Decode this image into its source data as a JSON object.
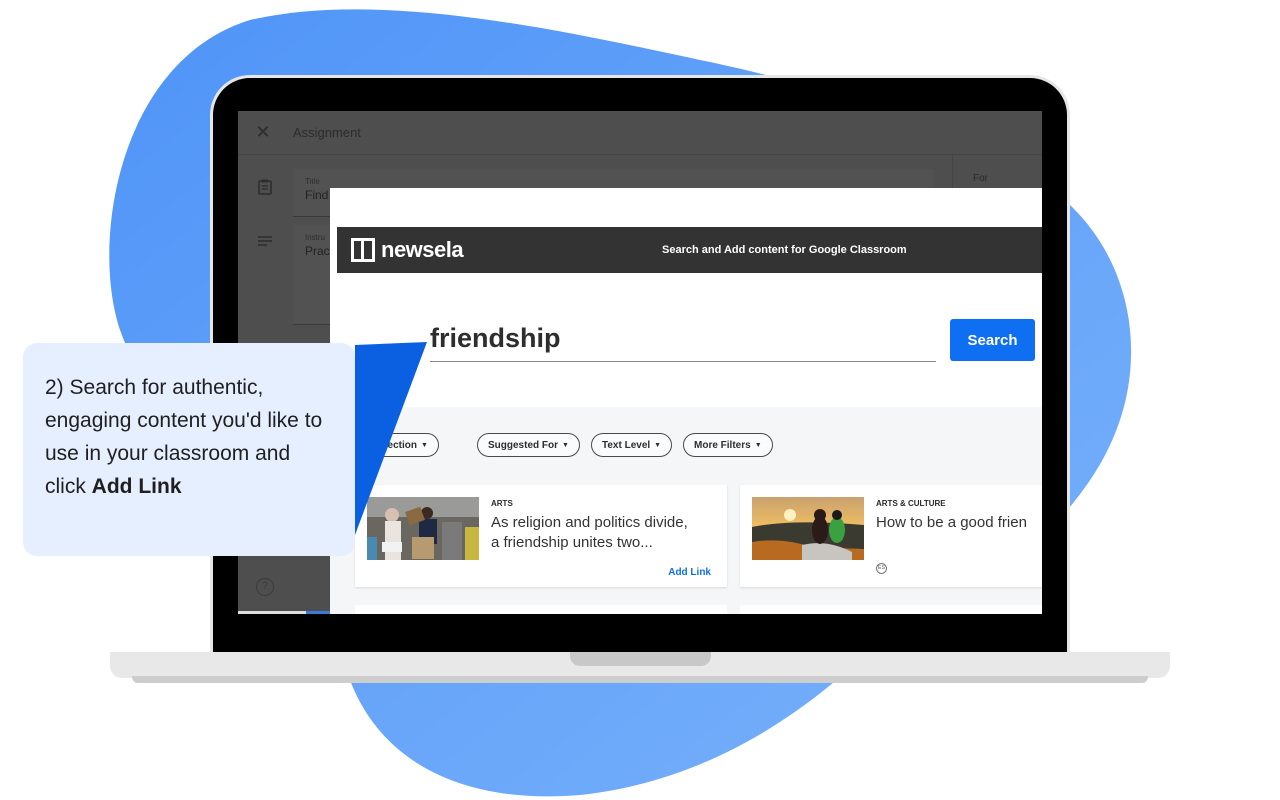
{
  "classroom": {
    "header_title": "Assignment",
    "title_field": {
      "label": "Title",
      "value": "Find"
    },
    "instructions_field": {
      "label": "Instru",
      "value": "Prac"
    },
    "right_panel_label": "For"
  },
  "newsela": {
    "logo_text": "newsela",
    "bar_caption": "Search and Add content for Google Classroom",
    "search": {
      "value": "friendship",
      "placeholder": "",
      "button_label": "Search"
    },
    "filters": [
      {
        "label": "m Collection"
      },
      {
        "label": "Suggested For"
      },
      {
        "label": "Text Level"
      },
      {
        "label": "More Filters"
      }
    ],
    "cards": [
      {
        "category": "ARTS",
        "title_line1": "As religion and politics divide,",
        "title_line2": "a friendship unites two...",
        "action_label": "Add Link"
      },
      {
        "category": "ARTS & CULTURE",
        "title_line1": "How to be a good frien",
        "title_line2": "",
        "language_badge": "ES"
      }
    ]
  },
  "callout": {
    "text_prefix": "2) Search for authentic, engaging content you'd like to use in your classroom and click ",
    "text_bold": "Add Link"
  },
  "colors": {
    "accent_blue": "#0f6ff2",
    "blob_blue": "#5b9cf8",
    "callout_bg": "#e6efff",
    "newsela_bar": "#333333"
  },
  "icons": {
    "close": "close-icon",
    "assignment": "clipboard-icon",
    "instructions": "lines-icon",
    "help": "help-circle-icon",
    "caret": "caret-down-icon"
  }
}
